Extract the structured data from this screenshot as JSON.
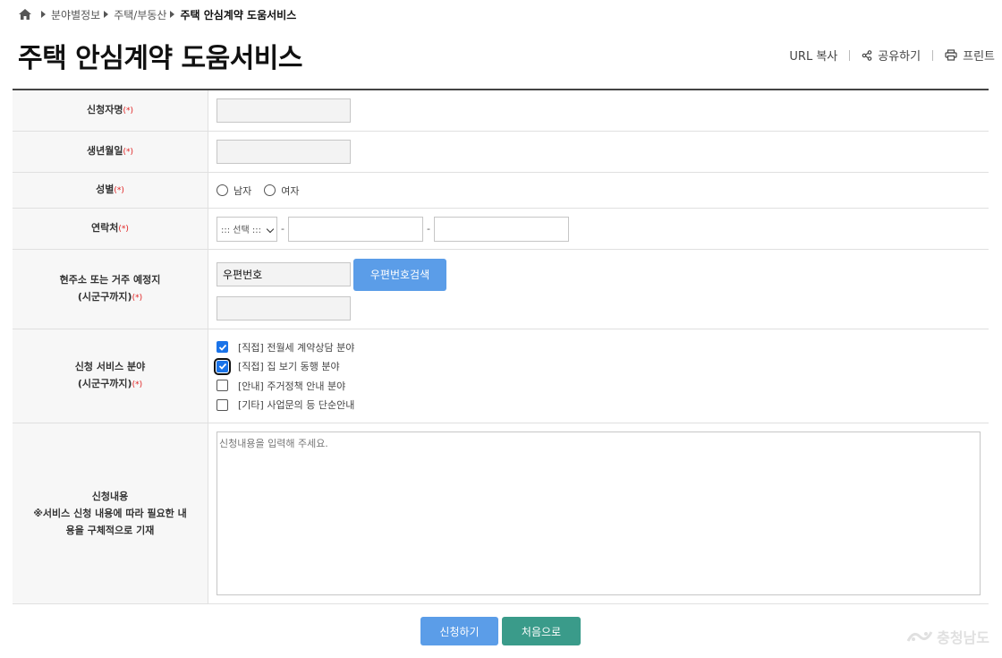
{
  "breadcrumb": {
    "items": [
      "분야별정보",
      "주택/부동산",
      "주택 안심계약 도움서비스"
    ]
  },
  "page": {
    "title": "주택 안심계약 도움서비스"
  },
  "utils": {
    "url_copy": "URL 복사",
    "share": "공유하기",
    "print": "프린트"
  },
  "form": {
    "required_mark": "(*)",
    "name_label": "신청자명",
    "birth_label": "생년월일",
    "gender_label": "성별",
    "gender_options": [
      "남자",
      "여자"
    ],
    "phone_label": "연락처",
    "phone_select": "::: 선택 :::",
    "phone_sep": "-",
    "address_label_1": "현주소 또는 거주 예정지",
    "address_label_2": "(시군구까지)",
    "zip_value": "우편번호",
    "zip_button": "우편번호검색",
    "service_label_1": "신청 서비스 분야",
    "service_label_2": "(시군구까지)",
    "services": [
      {
        "label": "[직접] 전월세 계약상담 분야",
        "checked": true
      },
      {
        "label": "[직접] 집 보기 동행 분야",
        "checked": true
      },
      {
        "label": "[안내] 주거정책 안내 분야",
        "checked": false
      },
      {
        "label": "[기타] 사업문의 등 단순안내",
        "checked": false
      }
    ],
    "content_label_1": "신청내용",
    "content_label_2": "※서비스 신청 내용에 따라 필요한 내",
    "content_label_3": "용을 구체적으로 기재",
    "content_placeholder": "신청내용을 입력해 주세요."
  },
  "actions": {
    "apply": "신청하기",
    "reset": "처음으로"
  },
  "watermark": "충청남도"
}
